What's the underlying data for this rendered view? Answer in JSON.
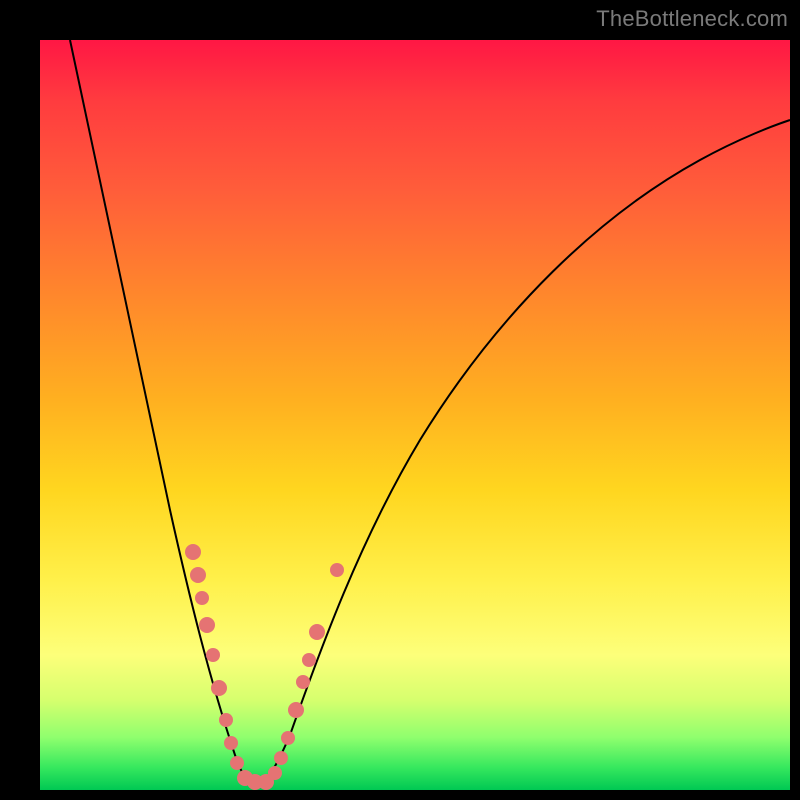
{
  "watermark": "TheBottleneck.com",
  "colors": {
    "gradient_top": "#ff1744",
    "gradient_mid1": "#ff8a2b",
    "gradient_mid2": "#ffd61f",
    "gradient_bottom": "#00c853",
    "curve": "#000000",
    "marker": "#e57373",
    "frame": "#000000"
  },
  "chart_data": {
    "type": "line",
    "title": "",
    "xlabel": "",
    "ylabel": "",
    "xlim": [
      0,
      100
    ],
    "ylim": [
      0,
      100
    ],
    "note": "V-shaped bottleneck curve. Y≈100 means severe bottleneck (red), Y≈0 means balanced (green). Minimum sits near x≈26 with y≈2.",
    "series": [
      {
        "name": "bottleneck-curve",
        "x": [
          4,
          6,
          8,
          10,
          12,
          14,
          16,
          18,
          20,
          22,
          24,
          26,
          28,
          30,
          32,
          34,
          36,
          40,
          45,
          50,
          55,
          60,
          65,
          70,
          75,
          80,
          85,
          90,
          95,
          100
        ],
        "y": [
          100,
          90,
          80,
          70,
          61,
          52,
          43,
          35,
          27,
          19,
          11,
          2,
          2,
          7,
          14,
          21,
          28,
          39,
          49,
          57,
          63,
          68,
          73,
          77,
          80,
          83,
          85,
          87,
          89,
          90
        ]
      }
    ],
    "markers": {
      "name": "sample-points",
      "note": "Salmon dots clustered on both arms near the valley and along the flat bottom.",
      "points": [
        {
          "x": 18.5,
          "y": 33
        },
        {
          "x": 19.5,
          "y": 29
        },
        {
          "x": 20.0,
          "y": 26
        },
        {
          "x": 20.7,
          "y": 22
        },
        {
          "x": 21.5,
          "y": 17
        },
        {
          "x": 22.3,
          "y": 13
        },
        {
          "x": 23.3,
          "y": 9
        },
        {
          "x": 24.0,
          "y": 6
        },
        {
          "x": 25.0,
          "y": 3
        },
        {
          "x": 26.0,
          "y": 2
        },
        {
          "x": 27.0,
          "y": 2
        },
        {
          "x": 28.0,
          "y": 2
        },
        {
          "x": 29.0,
          "y": 4
        },
        {
          "x": 29.8,
          "y": 6
        },
        {
          "x": 30.7,
          "y": 9
        },
        {
          "x": 31.7,
          "y": 13
        },
        {
          "x": 32.7,
          "y": 17
        },
        {
          "x": 33.5,
          "y": 20
        },
        {
          "x": 34.5,
          "y": 24
        },
        {
          "x": 37.0,
          "y": 33
        }
      ]
    }
  }
}
